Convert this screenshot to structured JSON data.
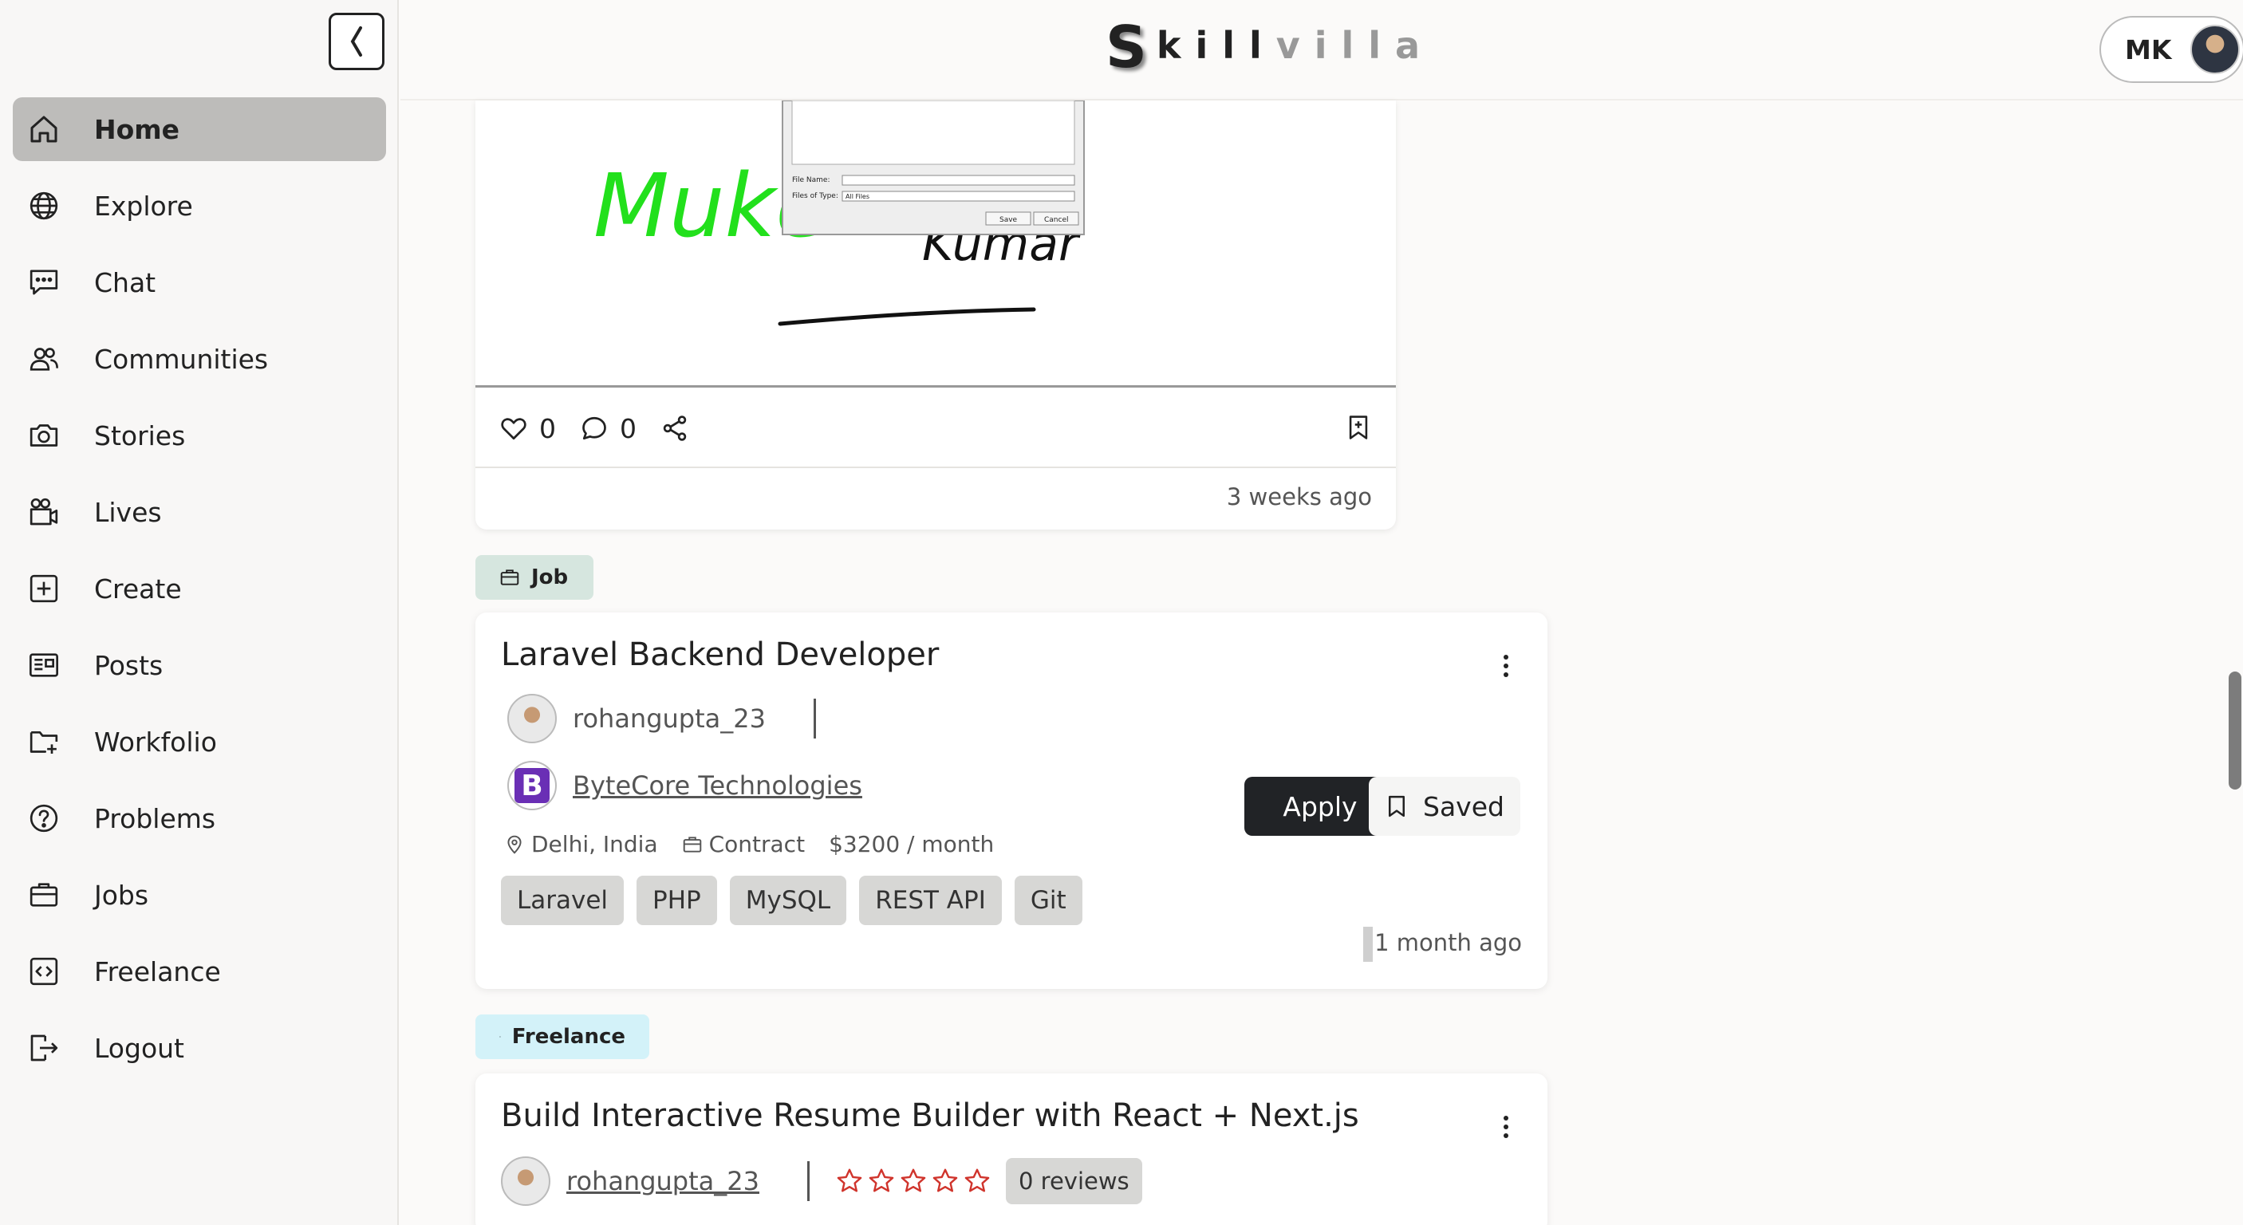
{
  "app": {
    "logo_first": "S",
    "logo_dark": "kill",
    "logo_light": "villa"
  },
  "user": {
    "initials": "MK"
  },
  "sidebar": {
    "items": [
      {
        "label": "Home",
        "icon": "home-icon",
        "active": true
      },
      {
        "label": "Explore",
        "icon": "globe-icon"
      },
      {
        "label": "Chat",
        "icon": "chat-icon"
      },
      {
        "label": "Communities",
        "icon": "users-icon"
      },
      {
        "label": "Stories",
        "icon": "camera-icon"
      },
      {
        "label": "Lives",
        "icon": "video-icon"
      },
      {
        "label": "Create",
        "icon": "plus-square-icon"
      },
      {
        "label": "Posts",
        "icon": "newspaper-icon"
      },
      {
        "label": "Workfolio",
        "icon": "folder-plus-icon"
      },
      {
        "label": "Problems",
        "icon": "question-icon"
      },
      {
        "label": "Jobs",
        "icon": "briefcase-icon"
      },
      {
        "label": "Freelance",
        "icon": "code-icon"
      },
      {
        "label": "Logout",
        "icon": "logout-icon"
      }
    ]
  },
  "post": {
    "handwriting_green": "Muke",
    "handwriting_black": "Kumar",
    "dialog": {
      "file_name_label": "File Name:",
      "files_of_type_label": "Files of Type:",
      "files_of_type_value": "All Files",
      "save": "Save",
      "cancel": "Cancel"
    },
    "likes": "0",
    "comments": "0",
    "time": "3 weeks ago"
  },
  "job": {
    "tag": "Job",
    "title": "Laravel Backend Developer",
    "poster": "rohangupta_23",
    "company_initial": "B",
    "company": "ByteCore Technologies",
    "location": "Delhi, India",
    "type": "Contract",
    "salary": "$3200 / month",
    "skills": [
      "Laravel",
      "PHP",
      "MySQL",
      "REST API",
      "Git"
    ],
    "apply_label": "Apply",
    "saved_label": "Saved",
    "time_first": "1",
    "time_rest": " month ago"
  },
  "freelance": {
    "tag": "Freelance",
    "title": "Build Interactive Resume Builder with React + Next.js",
    "poster": "rohangupta_23",
    "rating": 0,
    "reviews": "0 reviews",
    "star_color": "#d0342c"
  }
}
